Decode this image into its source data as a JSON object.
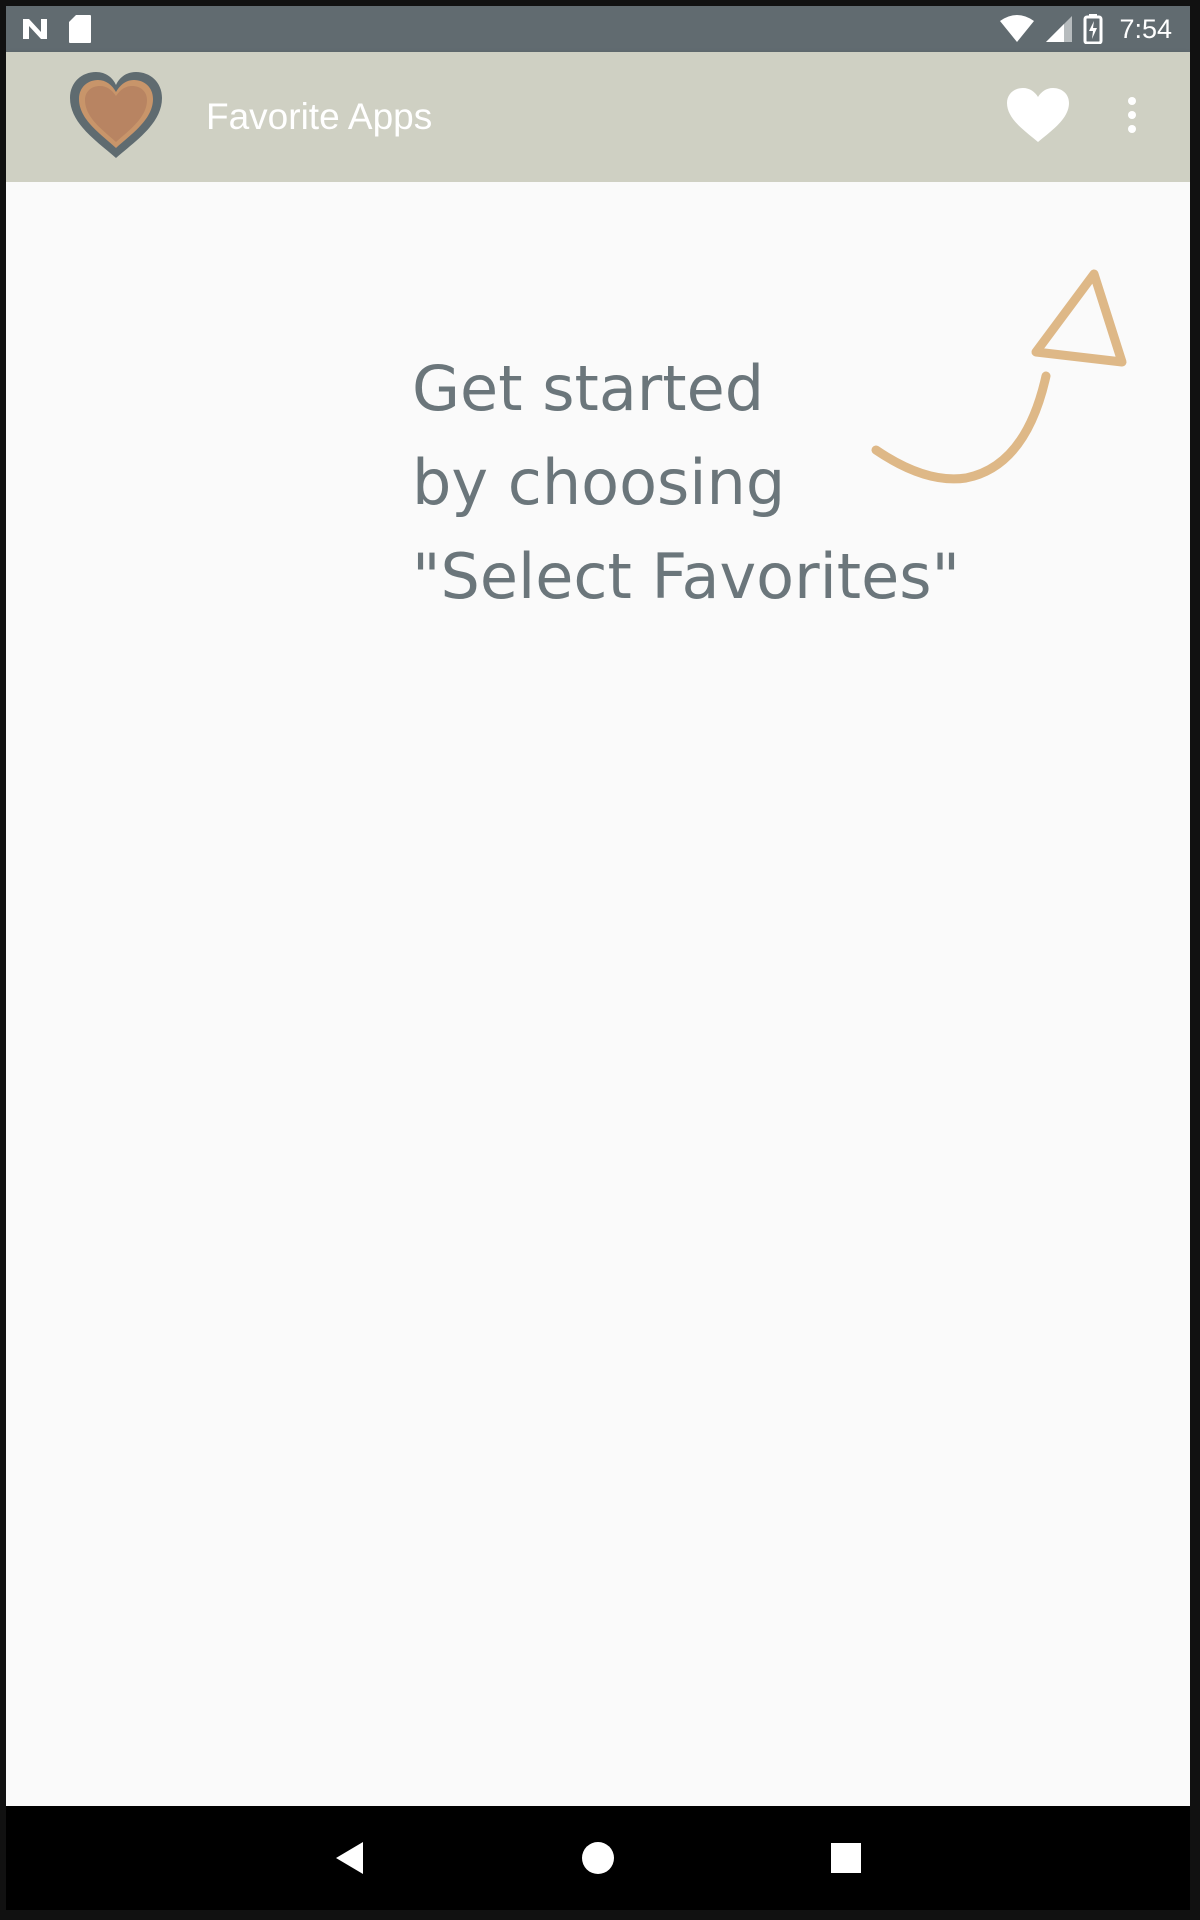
{
  "status_bar": {
    "time": "7:54",
    "left_icons": [
      "n-notification-icon",
      "sd-card-icon"
    ],
    "right_icons": [
      "wifi-icon",
      "signal-icon",
      "battery-charging-icon"
    ]
  },
  "app_bar": {
    "title": "Favorite Apps",
    "background_color": "#cfd0c3",
    "logo_icon": "heart-logo-icon",
    "favorite_icon": "heart-icon",
    "overflow_icon": "more-vert-icon"
  },
  "content": {
    "hint_lines": [
      "Get started",
      "by choosing",
      "\"Select Favorites\""
    ],
    "hint_color": "#6b767b",
    "arrow_icon": "curved-arrow-icon",
    "arrow_color": "#deb887"
  },
  "nav_bar": {
    "buttons": [
      "back-icon",
      "home-icon",
      "recents-icon"
    ]
  }
}
